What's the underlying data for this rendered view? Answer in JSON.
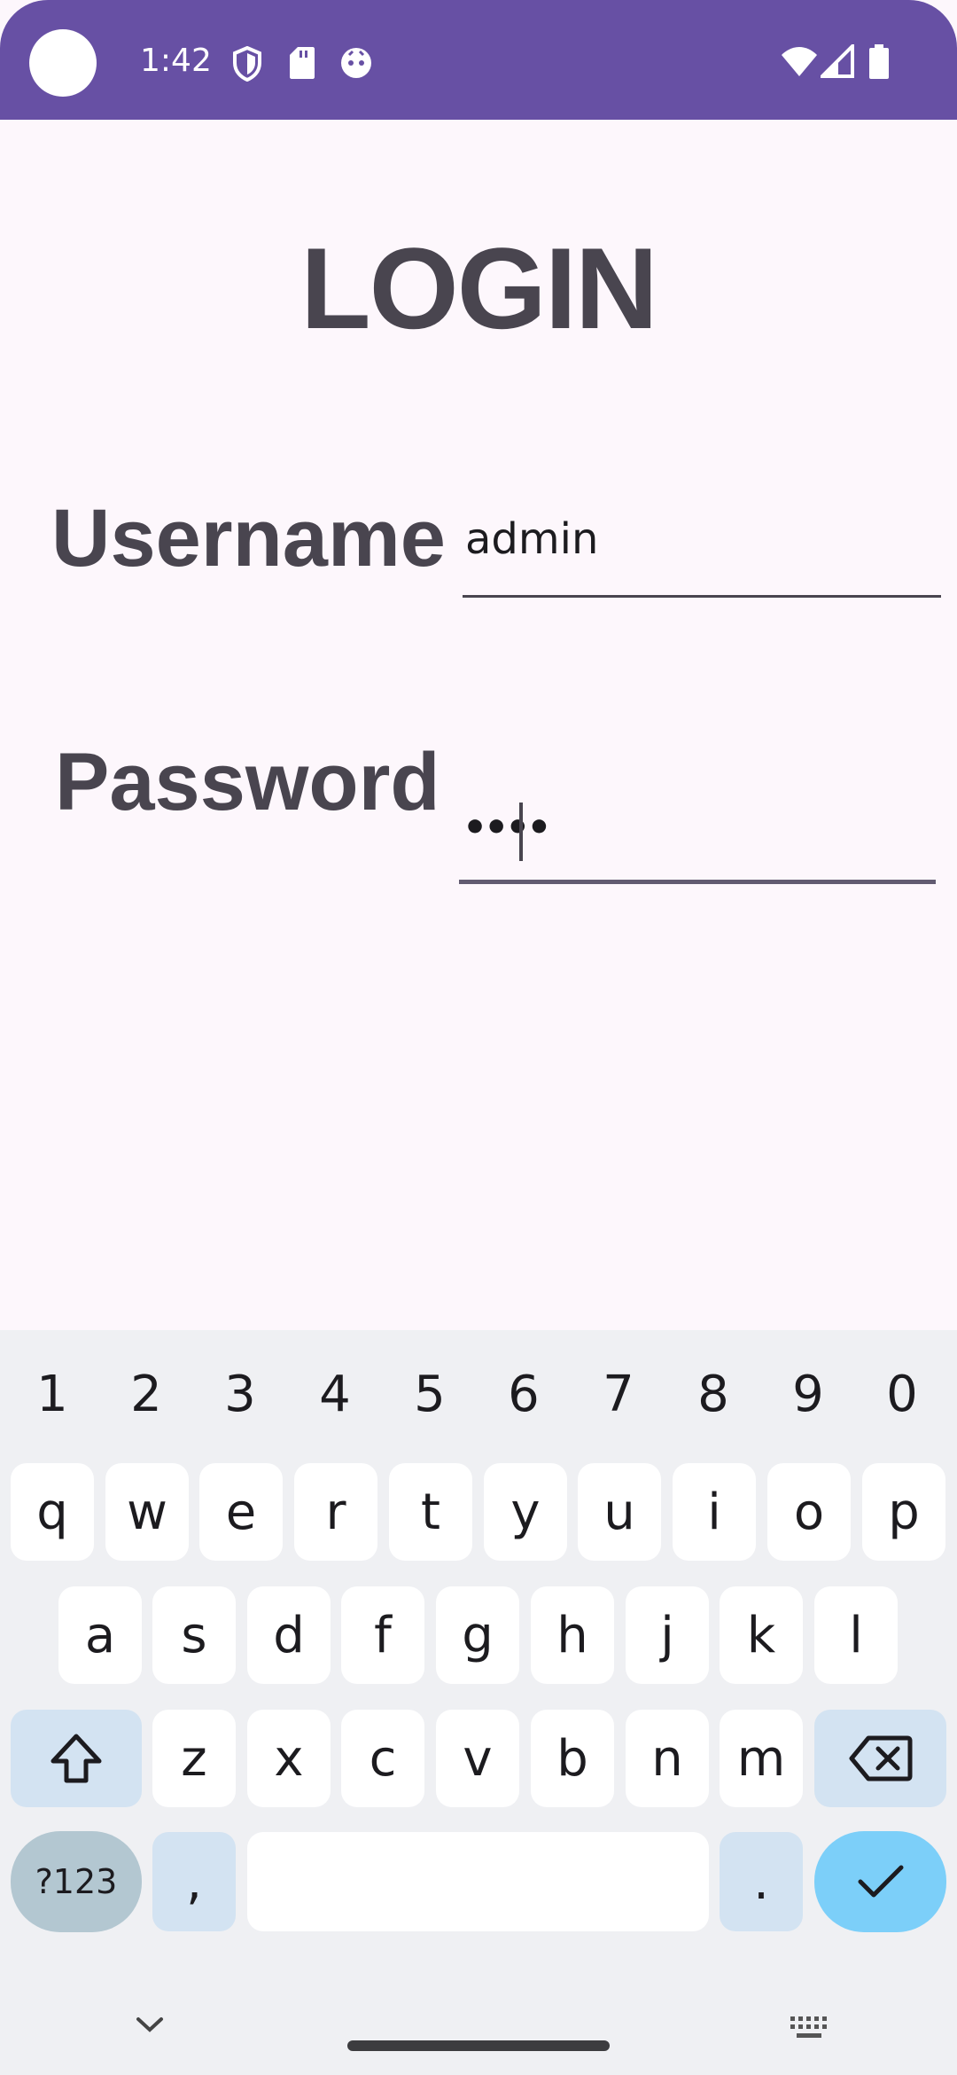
{
  "status_bar": {
    "time": "1:42",
    "left_icons": [
      "shield-icon",
      "sd-card-icon",
      "face-icon"
    ],
    "right_icons": [
      "wifi-icon",
      "signal-icon",
      "battery-icon"
    ],
    "color": "#6750a4"
  },
  "login": {
    "title": "LOGIN",
    "username_label": "Username",
    "username_value": "admin",
    "password_label": "Password",
    "password_value": "••••"
  },
  "keyboard": {
    "numbers": [
      "1",
      "2",
      "3",
      "4",
      "5",
      "6",
      "7",
      "8",
      "9",
      "0"
    ],
    "row1": [
      "q",
      "w",
      "e",
      "r",
      "t",
      "y",
      "u",
      "i",
      "o",
      "p"
    ],
    "row2": [
      "a",
      "s",
      "d",
      "f",
      "g",
      "h",
      "j",
      "k",
      "l"
    ],
    "row3": [
      "z",
      "x",
      "c",
      "v",
      "b",
      "n",
      "m"
    ],
    "symbols_label": "?123",
    "comma": ",",
    "period": ".",
    "enter_color": "#7ccff9"
  }
}
